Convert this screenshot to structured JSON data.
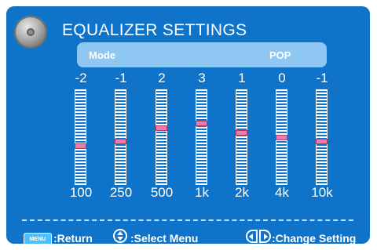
{
  "title": "EQUALIZER SETTINGS",
  "mode": {
    "label": "Mode",
    "value": "POP"
  },
  "bands": [
    {
      "value": "-2",
      "freq": "100",
      "level": -2
    },
    {
      "value": "-1",
      "freq": "250",
      "level": -1
    },
    {
      "value": "2",
      "freq": "500",
      "level": 2
    },
    {
      "value": "3",
      "freq": "1k",
      "level": 3
    },
    {
      "value": "1",
      "freq": "2k",
      "level": 1
    },
    {
      "value": "0",
      "freq": "4k",
      "level": 0
    },
    {
      "value": "-1",
      "freq": "10k",
      "level": -1
    }
  ],
  "footer": {
    "menu_badge": "MENU",
    "return_label": ":Return",
    "select_label": ":Select Menu",
    "change_label": ":Change Setting"
  },
  "colors": {
    "background": "#0f74c9",
    "mode_bar": "#8ec7f2",
    "knob": "#f07aa8"
  },
  "icons": {
    "logo": "speaker-disc-icon",
    "up_down": "up-down-arrows-icon",
    "left_right": "left-right-arrows-icon"
  }
}
